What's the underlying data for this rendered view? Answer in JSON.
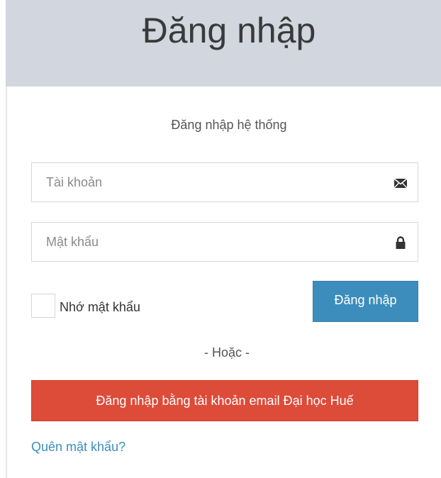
{
  "header": {
    "title": "Đăng nhập"
  },
  "form": {
    "subtitle": "Đăng nhập hệ thống",
    "username": {
      "value": "",
      "placeholder": "Tài khoản",
      "icon": "envelope-icon"
    },
    "password": {
      "value": "",
      "placeholder": "Mật khẩu",
      "icon": "lock-icon"
    },
    "remember": {
      "label": "Nhớ mật khẩu",
      "checked": false
    },
    "login_button": "Đăng nhập",
    "or_text": "- Hoặc -",
    "email_button": "Đăng nhập bằng tài khoản email Đại học Huế",
    "forgot_link": "Quên mật khẩu?"
  },
  "colors": {
    "header_bg": "#d2d6de",
    "primary": "#3c8dbc",
    "danger": "#dd4b39",
    "link": "#3c8dbc"
  }
}
